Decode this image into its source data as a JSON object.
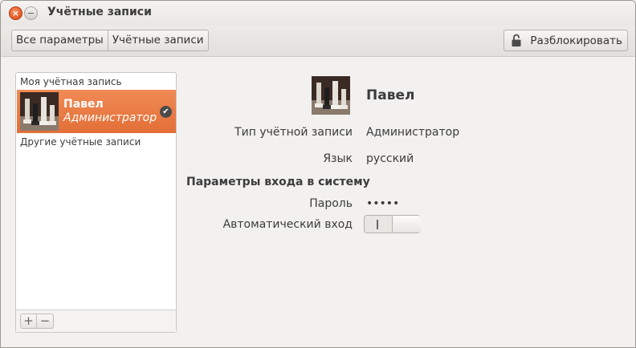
{
  "window": {
    "title": "Учётные записи",
    "close_glyph": "×",
    "minimize_glyph": "−"
  },
  "toolbar": {
    "breadcrumbs": [
      "Все параметры",
      "Учётные записи"
    ],
    "unlock_label": "Разблокировать",
    "unlock_icon": "lock-icon"
  },
  "sidebar": {
    "my_account_label": "Моя учётная запись",
    "other_accounts_label": "Другие учётные записи",
    "current_user": {
      "name": "Павел",
      "role": "Администратор",
      "check_glyph": "✔"
    },
    "add_glyph": "+",
    "remove_glyph": "−"
  },
  "details": {
    "full_name": "Павел",
    "account_type_label": "Тип учётной записи",
    "account_type_value": "Администратор",
    "language_label": "Язык",
    "language_value": "русский",
    "login_section_title": "Параметры входа в систему",
    "password_label": "Пароль",
    "password_value": "•••••",
    "autologin_label": "Автоматический вход",
    "autologin_enabled": false
  },
  "colors": {
    "selection": "#e8733c",
    "background": "#f2f1f0",
    "close_button": "#dd4814"
  }
}
